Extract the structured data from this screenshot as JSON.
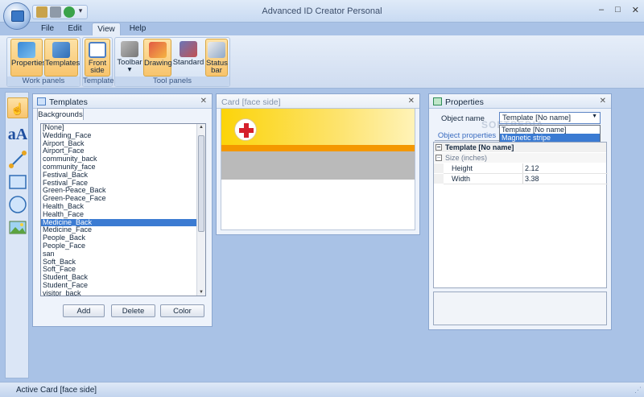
{
  "window": {
    "title": "Advanced ID Creator Personal"
  },
  "ribbon": {
    "tabs": [
      {
        "label": "File"
      },
      {
        "label": "Edit"
      },
      {
        "label": "View"
      },
      {
        "label": "Help"
      }
    ],
    "groups": {
      "work_panels": {
        "label": "Work panels",
        "properties": "Properties",
        "templates": "Templates"
      },
      "template": {
        "label": "Template",
        "front_line1": "Front",
        "front_line2": "side"
      },
      "tool_panels": {
        "label": "Tool panels",
        "toolbar": "Toolbar",
        "drawing": "Drawing",
        "standard": "Standard",
        "status_line1": "Status",
        "status_line2": "bar"
      }
    }
  },
  "templates_panel": {
    "title": "Templates",
    "tab": "Backgrounds",
    "items": [
      "[None]",
      "Wedding_Face",
      "Airport_Back",
      "Airport_Face",
      "community_back",
      "community_face",
      "Festival_Back",
      "Festival_Face",
      "Green-Peace_Back",
      "Green-Peace_Face",
      "Health_Back",
      "Health_Face",
      "Medicine_Back",
      "Medicine_Face",
      "People_Back",
      "People_Face",
      "san",
      "Soft_Back",
      "Soft_Face",
      "Student_Back",
      "Student_Face",
      "visitor_back"
    ],
    "selected_index": 12,
    "buttons": {
      "add": "Add",
      "delete": "Delete",
      "color": "Color"
    }
  },
  "card_panel": {
    "title": "Card [face side]"
  },
  "properties_panel": {
    "title": "Properties",
    "object_name_label": "Object name",
    "object_name_value": "Template [No name]",
    "dropdown_options": [
      "Template [No name]",
      "Magnetic stripe"
    ],
    "highlighted_option": 1,
    "tab": "Object properties",
    "grid": {
      "category": "Template [No name]",
      "subcategory": "Size (inches)",
      "rows": [
        {
          "key": "Height",
          "value": "2.12"
        },
        {
          "key": "Width",
          "value": "3.38"
        }
      ]
    }
  },
  "watermark": "SOFTPEDIA",
  "statusbar": {
    "text": "Active Card [face side]"
  },
  "colors": {
    "accent": "#3b7bd2",
    "active_button": "#f8c46d",
    "card_yellow": "#fcd40a",
    "card_orange": "#f49800"
  },
  "icons": [
    "app-orb-icon",
    "key-icon",
    "folder-icon",
    "save-icon",
    "red-cross-icon"
  ]
}
